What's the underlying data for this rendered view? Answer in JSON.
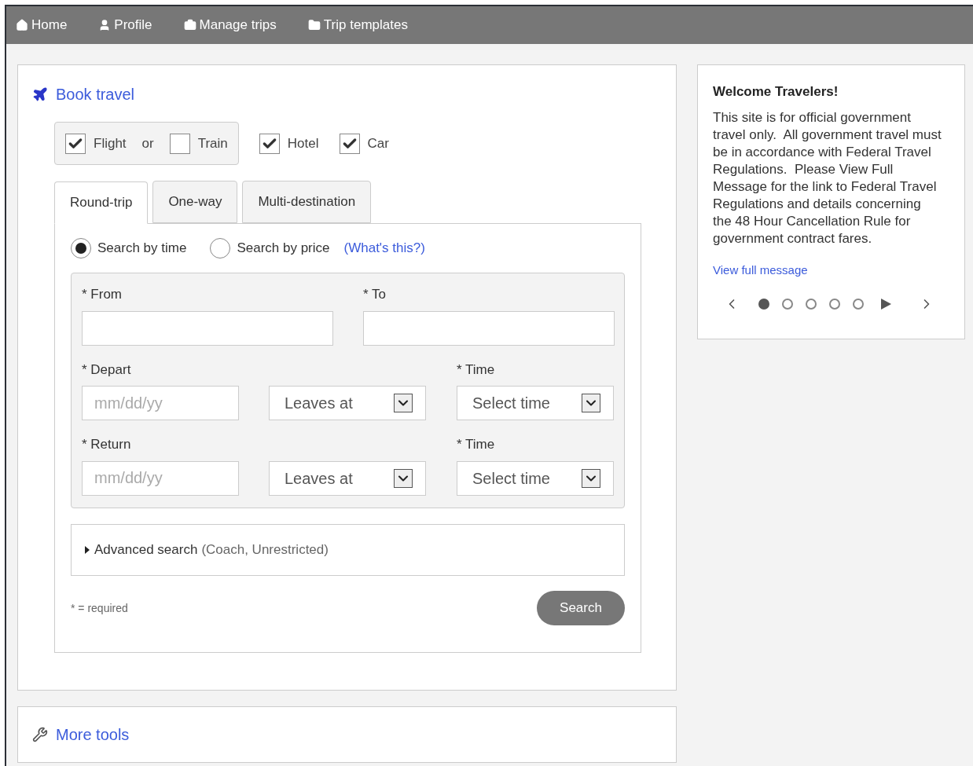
{
  "nav": [
    {
      "label": "Home"
    },
    {
      "label": "Profile"
    },
    {
      "label": "Manage trips"
    },
    {
      "label": "Trip templates"
    }
  ],
  "book": {
    "title": "Book travel",
    "modes": {
      "first": {
        "label": "Flight",
        "checked": true
      },
      "separator": "or",
      "second": {
        "label": "Train",
        "checked": false
      }
    },
    "extras": [
      {
        "label": "Hotel",
        "checked": true
      },
      {
        "label": "Car",
        "checked": true
      }
    ],
    "tabs": [
      {
        "label": "Round-trip",
        "selected": true
      },
      {
        "label": "One-way",
        "selected": false
      },
      {
        "label": "Multi-destination",
        "selected": false
      }
    ],
    "search_by": [
      {
        "label": "Search by time",
        "selected": true
      },
      {
        "label": "Search by price",
        "selected": false
      }
    ],
    "help_link": "(What's this?)",
    "from_label": "* From",
    "to_label": "* To",
    "legs": [
      {
        "label": "* Depart",
        "date_placeholder": "mm/dd/yy",
        "leaves": "Leaves at",
        "time_label": "* Time",
        "time": "Select time"
      },
      {
        "label": "* Return",
        "date_placeholder": "mm/dd/yy",
        "leaves": "Leaves at",
        "time_label": "* Time",
        "time": "Select time"
      }
    ],
    "advanced": {
      "label": "Advanced search",
      "detail": "(Coach, Unrestricted)",
      "expanded": false
    },
    "required_note": "* = required",
    "search_button": "Search"
  },
  "more_tools": {
    "title": "More tools"
  },
  "welcome": {
    "title": "Welcome Travelers!",
    "paragraphs": [
      "This site is for official government travel only.  All government travel must be in accordance with Federal Travel Regulations.  Please View Full Message for the link to Federal Travel",
      "Regulations and details concerning the 48 Hour Cancellation Rule for government contract fares."
    ],
    "link": "View full message",
    "dots": [
      {
        "selected": true
      },
      {
        "selected": false
      },
      {
        "selected": false
      },
      {
        "selected": false
      },
      {
        "selected": false
      }
    ]
  }
}
